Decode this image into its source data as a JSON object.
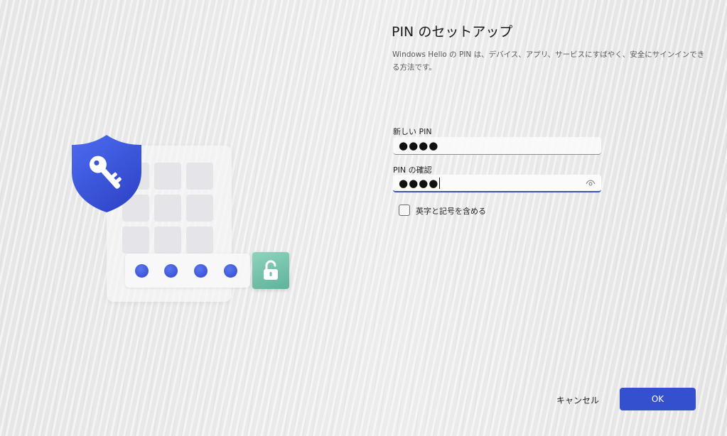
{
  "dialog": {
    "title": "PIN のセットアップ",
    "description": "Windows Hello の PIN は、デバイス、アプリ、サービスにすばやく、安全にサインインできる方法です。"
  },
  "new_pin": {
    "label": "新しい PIN",
    "value": "●●●●"
  },
  "confirm_pin": {
    "label": "PIN の確認",
    "value": "●●●●"
  },
  "include_letters": {
    "label": "英字と記号を含める",
    "checked": false
  },
  "buttons": {
    "cancel": "キャンセル",
    "ok": "OK"
  },
  "icons": {
    "shield": "shield-key-icon",
    "unlock": "unlock-icon",
    "reveal": "eye-icon"
  },
  "colors": {
    "accent": "#3550cc",
    "shield": "#3f5ae0",
    "unlock_tile": "#6fbfa8",
    "pin_dot": "#4a63e0"
  }
}
